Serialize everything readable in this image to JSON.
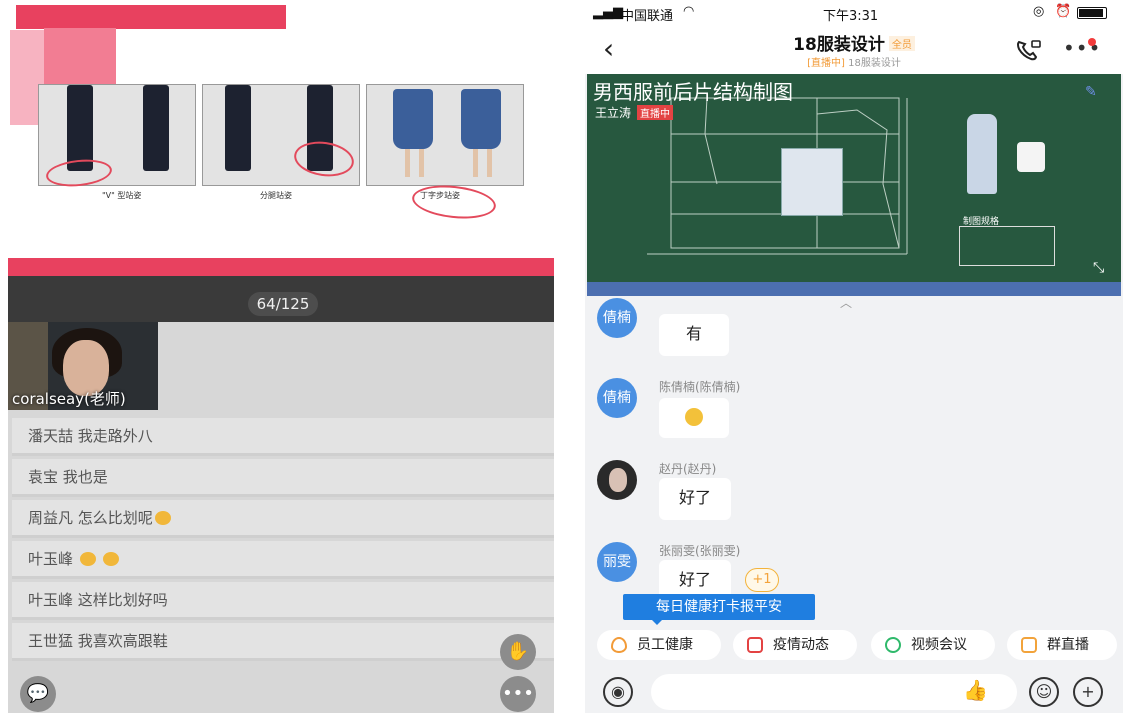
{
  "left": {
    "slide_captions": [
      "\"V\" 型站姿",
      "分腿站姿",
      "丁字步站姿"
    ],
    "page_indicator": "64/125",
    "teacher_label": "coralseay(老师)",
    "messages": [
      {
        "user": "潘天喆",
        "text": "我走路外八"
      },
      {
        "user": "袁宝",
        "text": "我也是"
      },
      {
        "user": "周益凡",
        "text": "怎么比划呢"
      },
      {
        "user": "叶玉峰",
        "text": ""
      },
      {
        "user": "叶玉峰",
        "text": "这样比划好吗"
      },
      {
        "user": "王世猛",
        "text": "我喜欢高跟鞋"
      }
    ]
  },
  "right": {
    "status": {
      "carrier": "中国联通",
      "time": "下午3:31"
    },
    "header": {
      "title": "18服装设计",
      "badge": "全员",
      "live_tag": "[直播中]",
      "subtitle": "18服装设计"
    },
    "video": {
      "board_title": "男西服前后片结构制图",
      "teacher": "王立涛",
      "live_tag": "直播中",
      "spec_title": "制图规格"
    },
    "chat": [
      {
        "avatar": "倩楠",
        "name": "",
        "text": "有"
      },
      {
        "avatar": "倩楠",
        "name": "陈倩楠(陈倩楠)",
        "text": ""
      },
      {
        "avatar": "",
        "name": "赵丹(赵丹)",
        "text": "好了"
      },
      {
        "avatar": "丽雯",
        "name": "张丽雯(张丽雯)",
        "text": "好了"
      }
    ],
    "plus_one": "+1",
    "tooltip": "每日健康打卡报平安",
    "quick_actions": [
      {
        "label": "员工健康",
        "color": "#f29b38"
      },
      {
        "label": "疫情动态",
        "color": "#e34343"
      },
      {
        "label": "视频会议",
        "color": "#2fb96b"
      },
      {
        "label": "群直播",
        "color": "#f2a33b"
      }
    ]
  }
}
